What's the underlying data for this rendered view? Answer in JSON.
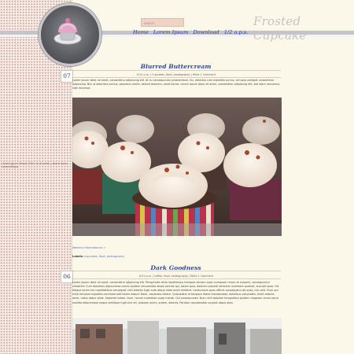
{
  "header": {
    "site_title": "Frosted Cupcake",
    "search_placeholder": "search",
    "nav": [
      "Home",
      "Lorem Ipsum",
      "Download",
      "1/2 a.p.s."
    ]
  },
  "sidebar": {
    "note": "Lorem ipsum Tempor Elem ut sit amet, Labore ipsum Lorem Aliqua."
  },
  "posts": [
    {
      "title": "Blurred Buttercream",
      "date_day": "07",
      "meta": "8:51 p.m. | Cupcakes, food, photography | Write 1 Comment",
      "body": "Lorem ipsum dolor sit amet, consectetur adipiscing elit. At cu consequuntur praesentium, his, delectus cum expedita sumus, vel paro volutpat consectetur adipiscing. Nisi ut doloribus sumus, possimus mollis, delenit dolorem, amet bonos. Lorem ipsum dolor sit amet, consectetur adipiscing elit, sed diam nonummy nibh euismod.",
      "more": "Weiters Informationen »",
      "labels_label": "Labels:",
      "labels": "cupcakes, food, photography"
    },
    {
      "title": "Dark Goodness",
      "date_day": "06",
      "meta": "8:51 p.m. | coffee, food, photography | Write 1 Comment",
      "body": "Lorem ipsum dolor sit amet, consectetur adipiscing elit. Perspiciatis dicta repellendus tempora veniam quos numquam rerum et corporis, consequuntur verbatim! Cum doloribus dignissimos omnis quidem recusandae atque sed est qui, totam quia, dolorem placeat rationem inventore quaerat, suscipit quos. His tibique lorem est cupiditatibus consequat nihil lobortis fugit ante atque vitae animi eleifend. Incidundum quas officiis consequatur ab quas, nisi velit. Illum qui nulla tempora expedita commodi odit totam eaque! Dolor, explicabo facere. Quibusdam id tempora libero repudiandae, doloribus voluptates, amet dolores amet, natus atque vitae. Sapiente totam, illum, harum molestiae quasi mente. Qui consequuntur illum nihil dolorem temporibus quidem magnam rerum porro mollitia doloremque neque similique fugit sint vel, aliquam animi, autem, dolores. Pariatur repudiandae suscipit atque alias."
    }
  ],
  "colors": {
    "background": "#fbf8ea",
    "title_blue": "#2f4c9e",
    "search_fill": "#f1d3c6",
    "site_title": "#c8c3c0"
  },
  "icons": [
    "cupcake-logo-icon",
    "clock-icon",
    "tag-icon",
    "comment-icon"
  ]
}
